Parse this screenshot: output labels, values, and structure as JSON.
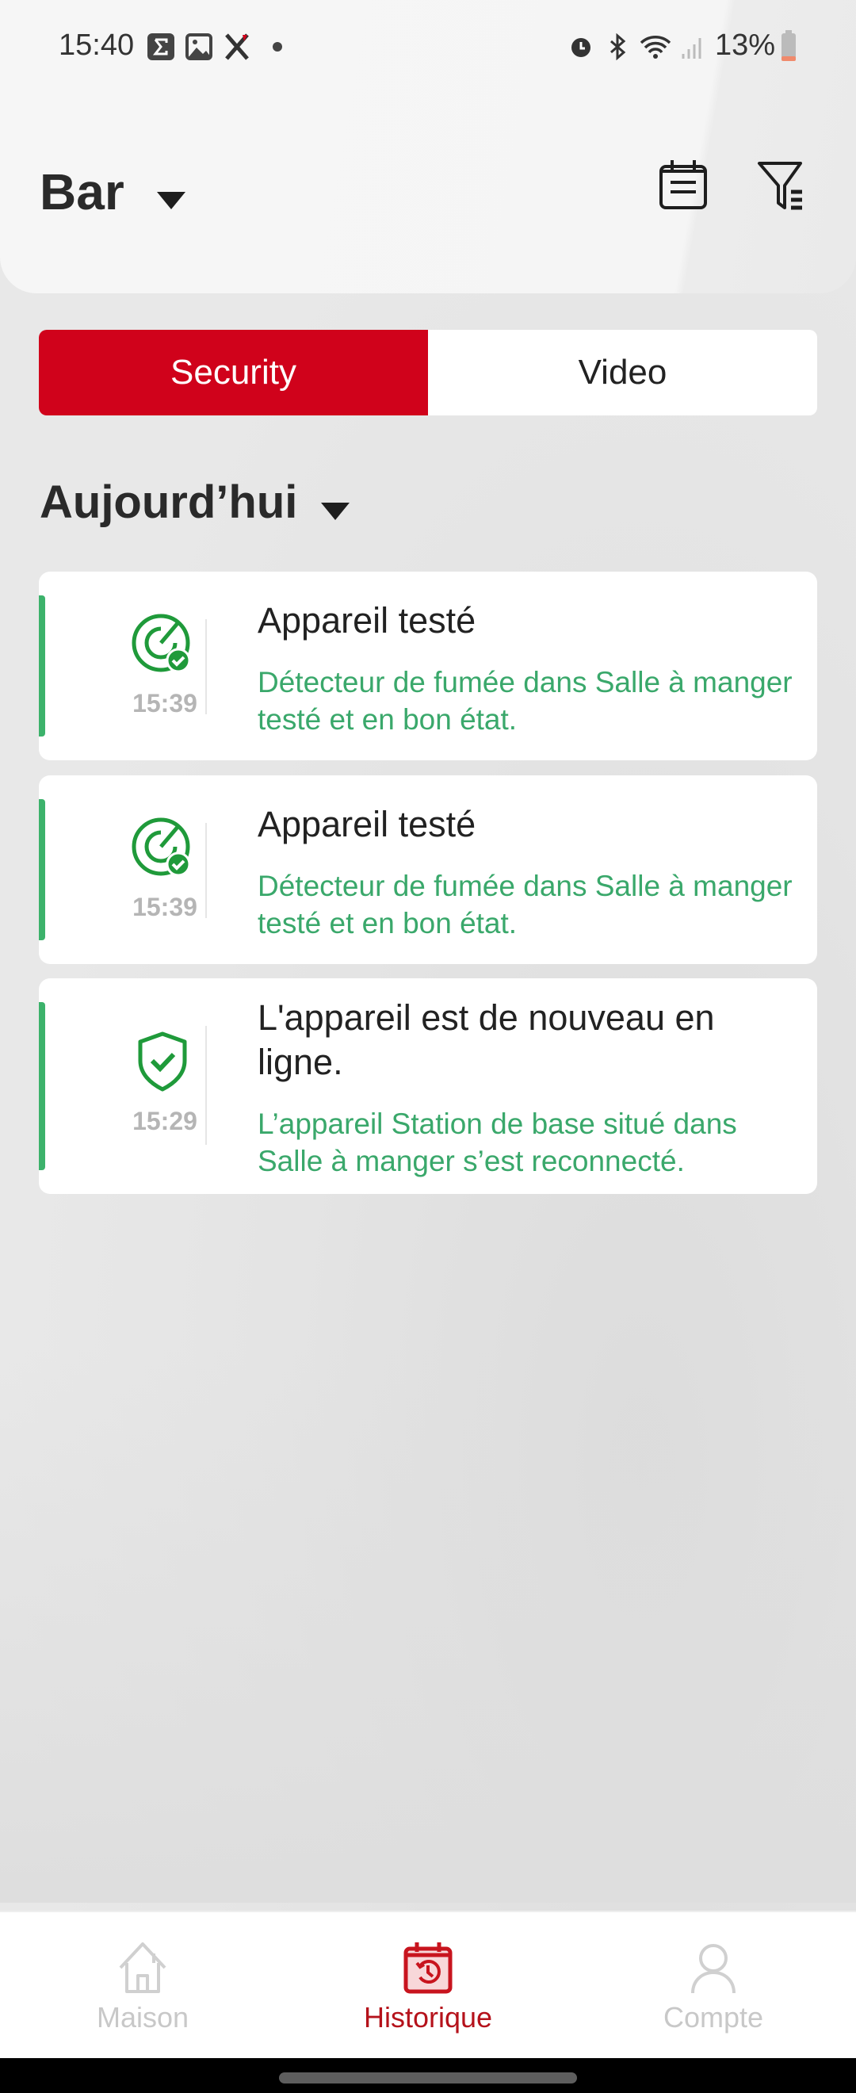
{
  "status_bar": {
    "time": "15:40",
    "battery": "13%",
    "icons": [
      "sigma-icon",
      "gallery-icon",
      "x-icon",
      "dot-icon",
      "alarm-icon",
      "bluetooth-icon",
      "wifi-icon",
      "signal-icon",
      "battery-icon"
    ]
  },
  "header": {
    "title": "Bar",
    "icons": [
      "calendar-icon",
      "filter-icon"
    ]
  },
  "tabs": [
    {
      "label": "Security",
      "active": true
    },
    {
      "label": "Video",
      "active": false
    }
  ],
  "section": {
    "label": "Aujourd’hui"
  },
  "colors": {
    "accent": "#d0021b",
    "success": "#3aa86b",
    "nav_active": "#b5121b"
  },
  "events": [
    {
      "icon": "radar-check-icon",
      "time": "15:39",
      "title": "Appareil testé",
      "description": "Détecteur de fumée dans Salle à manger testé et en bon état."
    },
    {
      "icon": "radar-check-icon",
      "time": "15:39",
      "title": "Appareil testé",
      "description": "Détecteur de fumée dans Salle à manger testé et en bon état."
    },
    {
      "icon": "shield-check-icon",
      "time": "15:29",
      "title": "L'appareil est de nouveau en ligne.",
      "description": "L’appareil Station de base situé dans Salle à manger s’est reconnecté."
    }
  ],
  "nav": [
    {
      "label": "Maison",
      "icon": "home-icon"
    },
    {
      "label": "Historique",
      "icon": "history-icon",
      "active": true
    },
    {
      "label": "Compte",
      "icon": "user-icon"
    }
  ]
}
